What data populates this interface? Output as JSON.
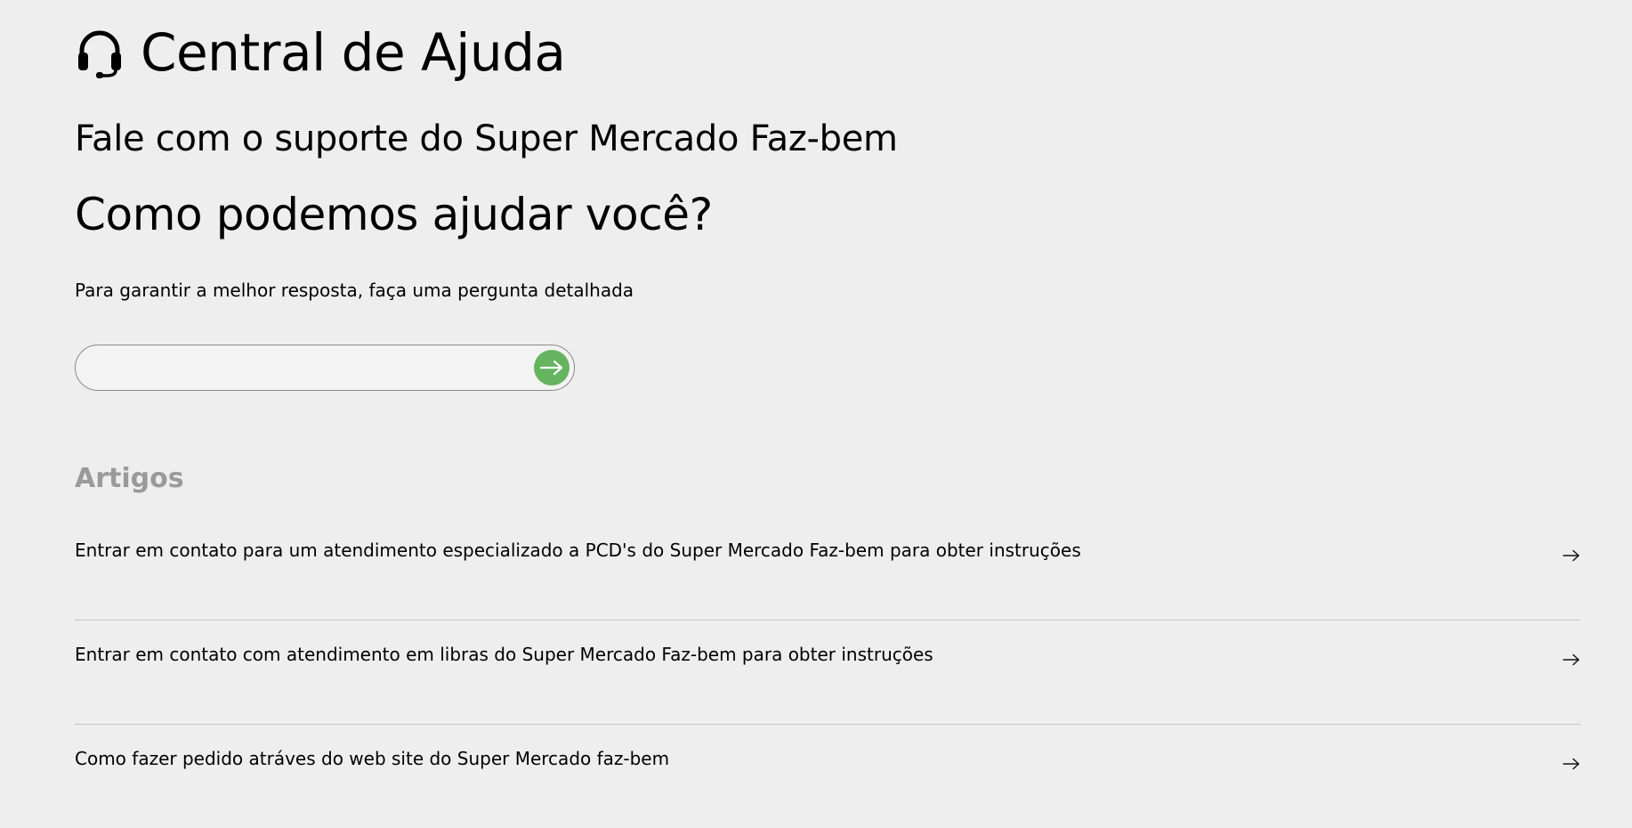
{
  "header": {
    "title": "Central de Ajuda",
    "icon": "headset-icon"
  },
  "subtitle": "Fale com o suporte do Super Mercado Faz-bem",
  "question": "Como podemos ajudar você?",
  "hint": "Para garantir a melhor resposta, faça uma pergunta detalhada",
  "search": {
    "value": "",
    "placeholder": "",
    "button_icon": "arrow-right-icon",
    "button_color": "#66b45f"
  },
  "articles": {
    "heading": "Artigos",
    "items": [
      {
        "label": "Entrar em contato para um atendimento especializado a PCD's do Super Mercado Faz-bem para obter instruções",
        "icon": "arrow-right-icon"
      },
      {
        "label": "Entrar em contato com atendimento em libras do Super Mercado Faz-bem para obter instruções",
        "icon": "arrow-right-icon"
      },
      {
        "label": "Como fazer pedido atráves do web site do Super Mercado faz-bem",
        "icon": "arrow-right-icon"
      }
    ]
  },
  "colors": {
    "background": "#eeeeee",
    "accent": "#66b45f",
    "section_heading": "#9a9a9a",
    "divider": "#c6c6c6"
  }
}
